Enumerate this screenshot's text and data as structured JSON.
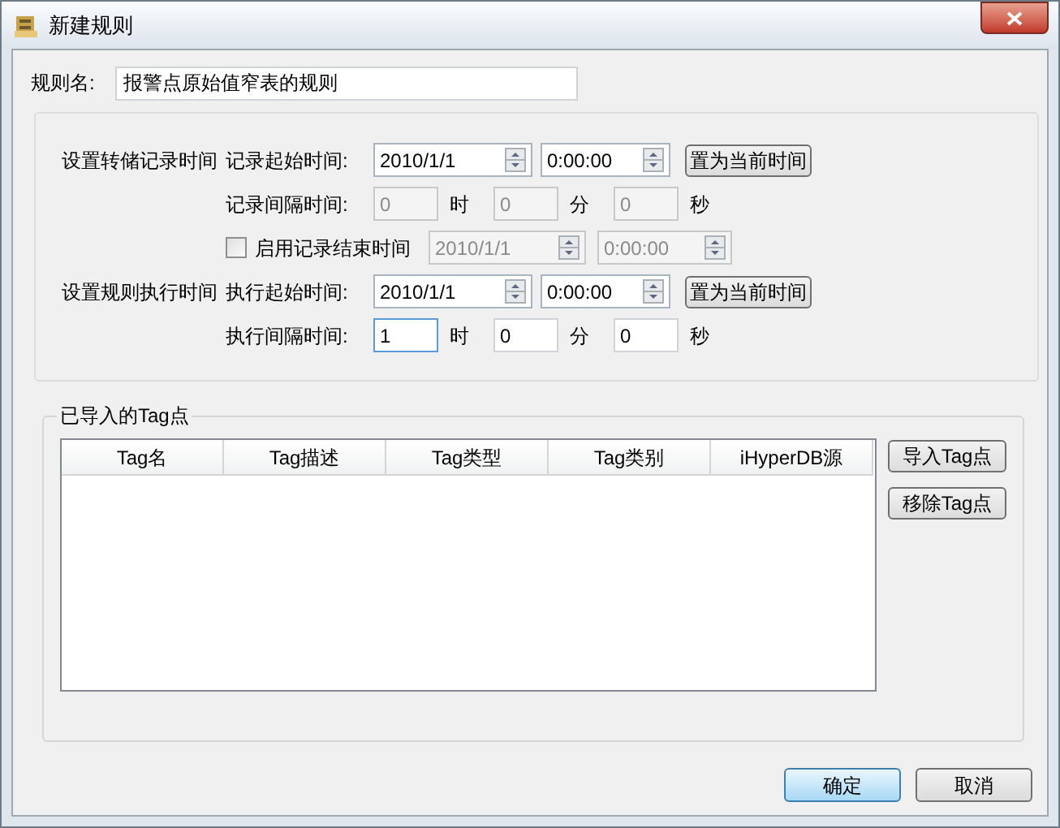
{
  "window": {
    "title": "新建规则"
  },
  "rule_name": {
    "label": "规则名:",
    "value": "报警点原始值窄表的规则"
  },
  "schedule": [
    {
      "kind": "datetime",
      "section": "设置转储记录时间",
      "label": "记录起始时间:",
      "date": {
        "value": "2010/1/1",
        "disabled": false
      },
      "time": {
        "value": "0:00:00",
        "disabled": false
      },
      "button": "置为当前时间"
    },
    {
      "kind": "interval",
      "label": "记录间隔时间:",
      "fields": [
        {
          "value": "0",
          "unit": "时",
          "disabled": true,
          "focused": false
        },
        {
          "value": "0",
          "unit": "分",
          "disabled": true,
          "focused": false
        },
        {
          "value": "0",
          "unit": "秒",
          "disabled": true,
          "focused": false
        }
      ]
    },
    {
      "kind": "checkbox",
      "label": "启用记录结束时间",
      "checked": false,
      "date": {
        "value": "2010/1/1",
        "disabled": true
      },
      "time": {
        "value": "0:00:00",
        "disabled": true
      }
    },
    {
      "kind": "datetime",
      "section": "设置规则执行时间",
      "label": "执行起始时间:",
      "date": {
        "value": "2010/1/1",
        "disabled": false
      },
      "time": {
        "value": "0:00:00",
        "disabled": false
      },
      "button": "置为当前时间"
    },
    {
      "kind": "interval",
      "label": "执行间隔时间:",
      "fields": [
        {
          "value": "1",
          "unit": "时",
          "disabled": false,
          "focused": true
        },
        {
          "value": "0",
          "unit": "分",
          "disabled": false,
          "focused": false
        },
        {
          "value": "0",
          "unit": "秒",
          "disabled": false,
          "focused": false
        }
      ]
    }
  ],
  "tags": {
    "title": "已导入的Tag点",
    "columns": [
      "Tag名",
      "Tag描述",
      "Tag类型",
      "Tag类别",
      "iHyperDB源"
    ],
    "buttons": [
      "导入Tag点",
      "移除Tag点"
    ]
  },
  "buttons": [
    {
      "label": "确定",
      "default": true
    },
    {
      "label": "取消",
      "default": false
    }
  ]
}
